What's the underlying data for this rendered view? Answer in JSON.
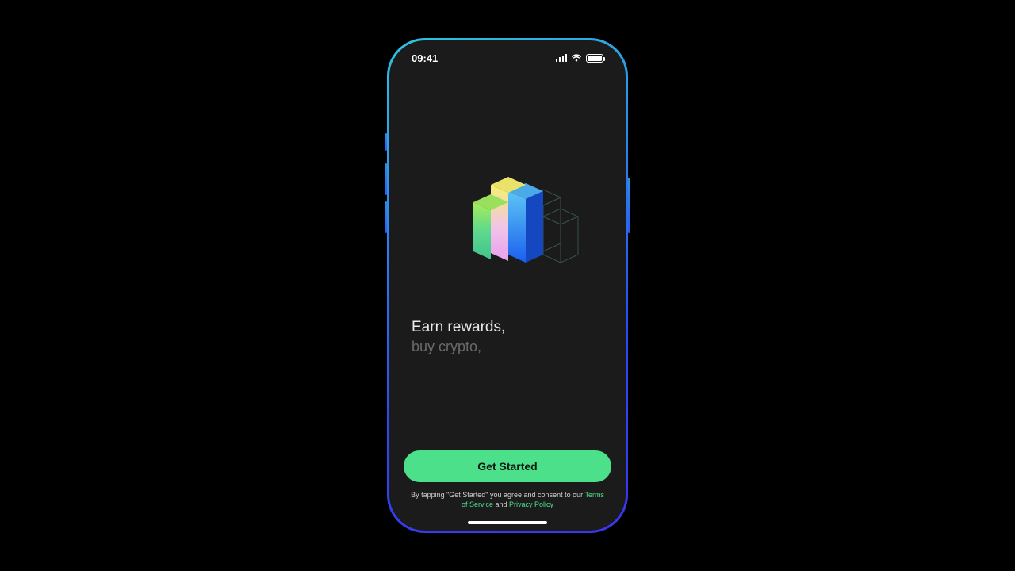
{
  "status": {
    "time": "09:41"
  },
  "tagline": {
    "line1": "Earn rewards,",
    "line2": "buy crypto,"
  },
  "cta": {
    "label": "Get Started"
  },
  "legal": {
    "prefix": "By tapping \"Get Started\" you agree and consent to our ",
    "tos": "Terms of Service",
    "conj": " and ",
    "privacy": "Privacy Policy"
  },
  "colors": {
    "accent": "#4de08a"
  }
}
